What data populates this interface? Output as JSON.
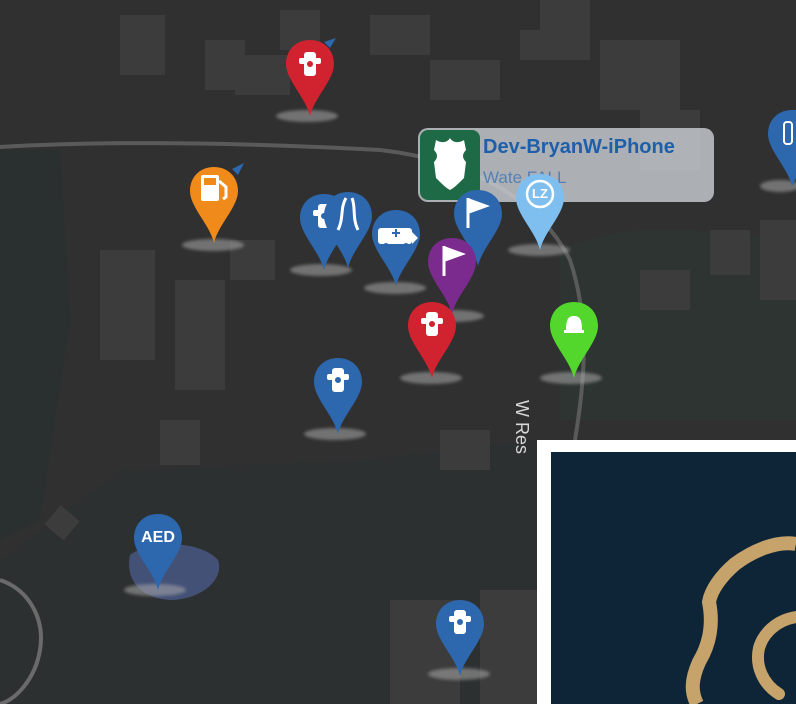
{
  "map": {
    "callout": {
      "device_name": "Dev-BryanW-iPhone",
      "subtitle": "Wate  FALL",
      "badge_icon": "shield-icon"
    },
    "road_label": "W Res",
    "colors": {
      "hydrant_red": "#d1232f",
      "hydrant_blue": "#2d67ad",
      "fuel_orange": "#f08a1a",
      "lz_light_blue": "#7fbff0",
      "flag_purple": "#7b2b8e",
      "green_marker": "#54d72c",
      "map_background": "#2f2f2f",
      "overlay_navy": "#0e2538",
      "logo_gold": "#c5a36a"
    },
    "markers": [
      {
        "type": "hydrant",
        "color": "red",
        "icon": "fire-hydrant-icon"
      },
      {
        "type": "fuel",
        "color": "orange",
        "icon": "fuel-pump-icon"
      },
      {
        "type": "hydrant",
        "color": "blue",
        "icon": "fire-hydrant-icon"
      },
      {
        "type": "road",
        "color": "blue",
        "icon": "road-icon"
      },
      {
        "type": "ambulance",
        "color": "blue",
        "icon": "ambulance-icon"
      },
      {
        "type": "flag",
        "color": "purple",
        "icon": "flag-icon"
      },
      {
        "type": "hydrant",
        "color": "red",
        "icon": "fire-hydrant-icon"
      },
      {
        "type": "landing-zone",
        "color": "light-blue",
        "icon": "lz-icon"
      },
      {
        "type": "alarm",
        "color": "green",
        "icon": "bell-icon"
      },
      {
        "type": "hydrant",
        "color": "blue",
        "icon": "fire-hydrant-icon"
      },
      {
        "type": "aed",
        "color": "blue",
        "icon": "aed-icon"
      },
      {
        "type": "hydrant",
        "color": "blue",
        "icon": "fire-hydrant-icon"
      },
      {
        "type": "oxygen",
        "color": "blue",
        "icon": "oxygen-tank-icon"
      }
    ],
    "aed_label": "AED",
    "lz_label": "LZ"
  }
}
